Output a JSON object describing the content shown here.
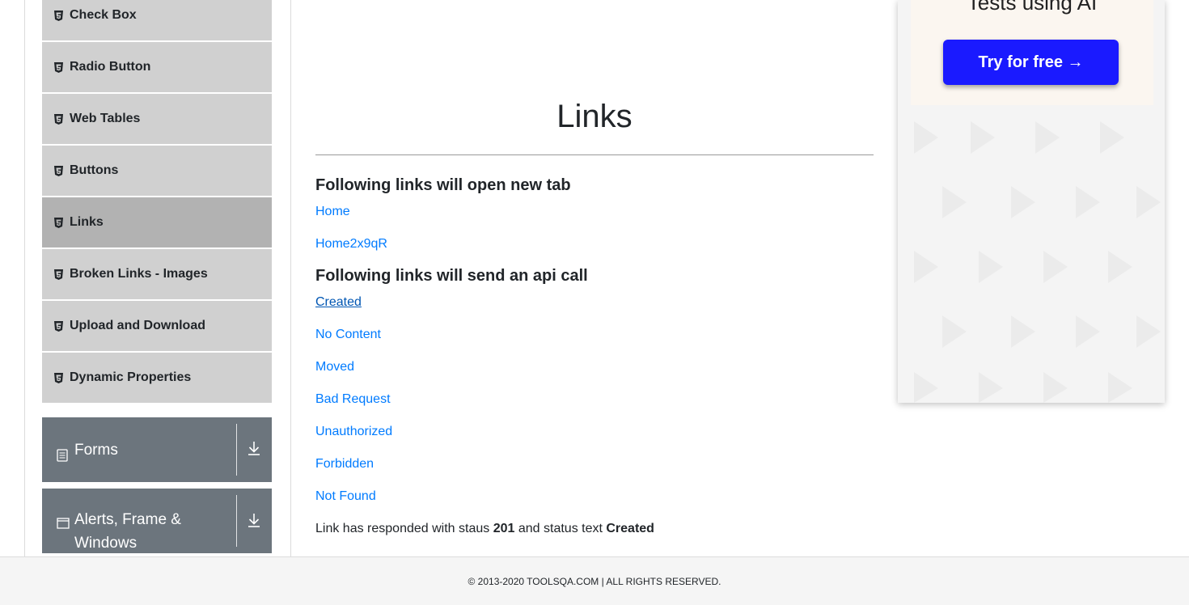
{
  "sidebar": {
    "items": [
      {
        "label": "Check Box",
        "icon": "html5-icon"
      },
      {
        "label": "Radio Button",
        "icon": "html5-icon"
      },
      {
        "label": "Web Tables",
        "icon": "html5-icon"
      },
      {
        "label": "Buttons",
        "icon": "html5-icon"
      },
      {
        "label": "Links",
        "icon": "html5-icon",
        "active": true
      },
      {
        "label": "Broken Links - Images",
        "icon": "html5-icon"
      },
      {
        "label": "Upload and Download",
        "icon": "html5-icon"
      },
      {
        "label": "Dynamic Properties",
        "icon": "html5-icon"
      }
    ],
    "groups": {
      "forms": {
        "label": "Forms",
        "icon": "document-icon"
      },
      "alerts": {
        "label": "Alerts, Frame & Windows",
        "icon": "window-icon"
      }
    }
  },
  "main": {
    "title": "Links",
    "section1": "Following links will open new tab",
    "new_tab_links": [
      "Home",
      "Home2x9qR"
    ],
    "section2": "Following links will send an api call",
    "api_links": [
      "Created",
      "No Content",
      "Moved",
      "Bad Request",
      "Unauthorized",
      "Forbidden",
      "Not Found"
    ],
    "response": {
      "prefix": "Link has responded with staus",
      "code": "201",
      "middle": "and status text",
      "text": "Created"
    }
  },
  "ad": {
    "heading": "Tests using AI",
    "button": "Try for free →"
  },
  "footer": {
    "text": "© 2013-2020 TOOLSQA.COM | ALL RIGHTS RESERVED."
  },
  "colors": {
    "link": "#007bff",
    "group_bg": "#6c757d",
    "menu_bg": "#d0d0d0",
    "menu_active": "#b2b2b2",
    "ad_button": "#1a1aff"
  }
}
